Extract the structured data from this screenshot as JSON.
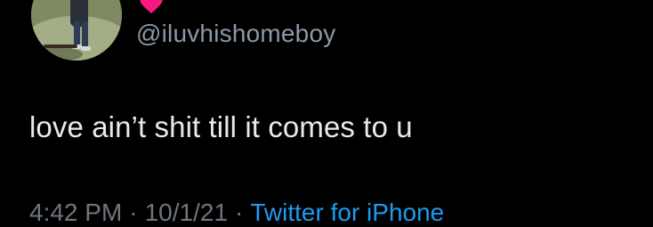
{
  "user": {
    "handle": "@iluvhishomeboy",
    "badge_icon": "heart-icon",
    "badge_color": "#f91880"
  },
  "tweet": {
    "text": "love ain’t shit till it comes to u"
  },
  "meta": {
    "time": "4:42 PM",
    "separator": "·",
    "date": "10/1/21",
    "source": "Twitter for iPhone"
  },
  "colors": {
    "background": "#000000",
    "text": "#e7e9ea",
    "muted": "#6e767d",
    "link": "#1d9bf0"
  }
}
